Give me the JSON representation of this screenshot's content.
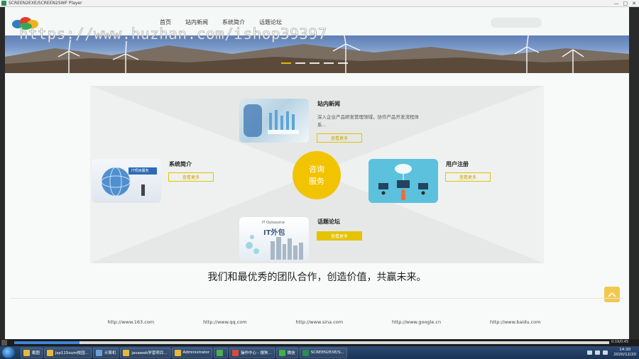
{
  "player": {
    "title": "SCREEN2EXE/SCREEN2SWF Player",
    "minimize": "—",
    "maximize": "□",
    "close": "✕",
    "time": "0:19/0:45",
    "progress": 0.11
  },
  "nav": {
    "items": [
      "首页",
      "站内新闻",
      "系统简介",
      "话题论坛"
    ],
    "search_placeholder": ""
  },
  "watermark": "https://www.huzhan.com/ishop39397",
  "banner": {
    "slide_count": 5,
    "active_slide": 0,
    "colors": {
      "active": "#e8b400"
    }
  },
  "cards": [
    {
      "id": "news",
      "title": "站内新闻",
      "desc": "深入企业产品研发管理领域，协作产品开发流程体系...",
      "button": "查看更多",
      "image_label": ""
    },
    {
      "id": "intro",
      "title": "系统简介",
      "desc": "",
      "button": "查看更多",
      "image_label": "IT项目服务"
    },
    {
      "id": "register",
      "title": "用户注册",
      "desc": "",
      "button": "查看更多",
      "image_label": ""
    },
    {
      "id": "forum",
      "title": "话题论坛",
      "desc": "",
      "button": "查看更多",
      "image_label_top": "IT Outsource",
      "image_label": "IT外包"
    }
  ],
  "center": {
    "line1": "咨询",
    "line2": "服务",
    "color": "#f2c400"
  },
  "slogan": "我们和最优秀的团队合作，创造价值，共赢未来。",
  "footer_links": [
    "http://www.163.com",
    "http://www.qq.com",
    "http://www.sina.com",
    "http://www.google.cn",
    "http://www.baidu.com"
  ],
  "taskbar": {
    "items": [
      {
        "label": "截图",
        "color": "#e7b83a"
      },
      {
        "label": "jsp115oum校园...",
        "color": "#e7b83a"
      },
      {
        "label": "计算机",
        "color": "#6a9fd8"
      },
      {
        "label": "javaweb学習项目...",
        "color": "#e7b83a"
      },
      {
        "label": "Administrator",
        "color": "#e7b83a"
      },
      {
        "label": "",
        "color": "#4caf50"
      },
      {
        "label": "操作中心 - 搜狗...",
        "color": "#d94b3b"
      },
      {
        "label": "微信",
        "color": "#3cb34a"
      },
      {
        "label": "SCREEN2EXE/S...",
        "color": "#2e8b57"
      }
    ],
    "clock_time": "14:30",
    "clock_date": "2020/12/20"
  }
}
